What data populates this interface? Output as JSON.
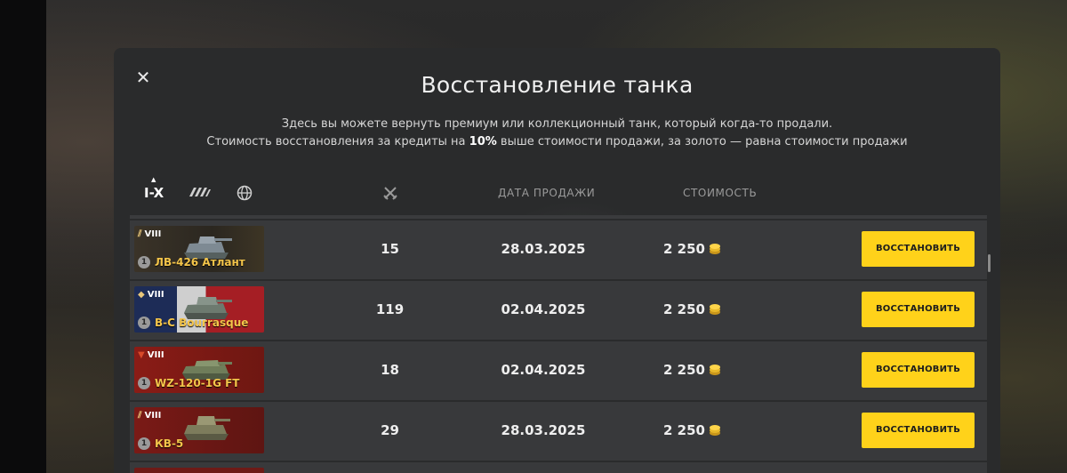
{
  "modal": {
    "title": "Восстановление танка",
    "subtitle_line1": "Здесь вы можете вернуть премиум или коллекционный танк, который когда-то продали.",
    "subtitle_line2_prefix": "Стоимость восстановления за кредиты на",
    "subtitle_line2_bold": "10%",
    "subtitle_line2_suffix": "выше стоимости продажи, за золото — равна стоимости продажи",
    "close_icon": "close-icon"
  },
  "filters": {
    "tier_label": "I-X",
    "type_icon": "tank-type-icon",
    "nation_icon": "globe-icon",
    "battles_icon": "crossed-swords-icon"
  },
  "columns": {
    "date": "ДАТА ПРОДАЖИ",
    "cost": "СТОИМОСТЬ"
  },
  "colors": {
    "accent": "#ffd21a",
    "tank_name": "#f4c54a",
    "row_bg": "#38393b",
    "modal_bg": "#2a2b2c"
  },
  "rows": [
    {
      "tier": "VIII",
      "mastery": "1",
      "name": "ЛВ-426 Атлант",
      "battles": "15",
      "date": "28.03.2025",
      "price": "2 250",
      "button": "ВОССТАНОВИТЬ",
      "nation": "ussr"
    },
    {
      "tier": "VIII",
      "mastery": "1",
      "name": "B-C Bourrasque",
      "battles": "119",
      "date": "02.04.2025",
      "price": "2 250",
      "button": "ВОССТАНОВИТЬ",
      "nation": "france"
    },
    {
      "tier": "VIII",
      "mastery": "1",
      "name": "WZ-120-1G FT",
      "battles": "18",
      "date": "02.04.2025",
      "price": "2 250",
      "button": "ВОССТАНОВИТЬ",
      "nation": "china"
    },
    {
      "tier": "VIII",
      "mastery": "1",
      "name": "КВ-5",
      "battles": "29",
      "date": "28.03.2025",
      "price": "2 250",
      "button": "ВОССТАНОВИТЬ",
      "nation": "ussr"
    }
  ]
}
